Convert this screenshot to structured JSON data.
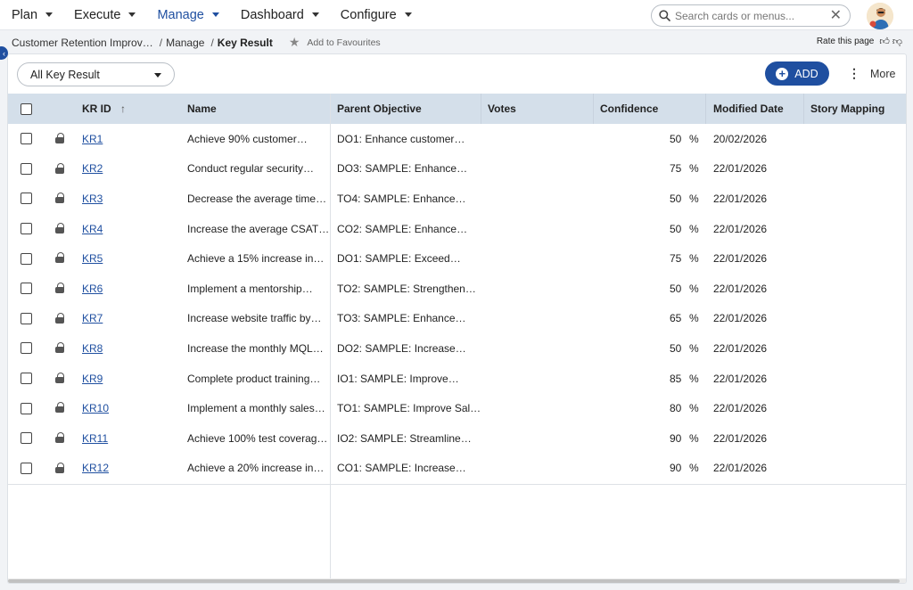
{
  "nav": {
    "items": [
      {
        "label": "Plan",
        "active": false
      },
      {
        "label": "Execute",
        "active": false
      },
      {
        "label": "Manage",
        "active": true
      },
      {
        "label": "Dashboard",
        "active": false
      },
      {
        "label": "Configure",
        "active": false
      }
    ],
    "search_placeholder": "Search cards or menus..."
  },
  "breadcrumb": {
    "items": [
      "Customer Retention Improv…",
      "Manage"
    ],
    "current": "Key Result",
    "favourite_label": "Add to Favourites",
    "rate_label": "Rate this page"
  },
  "toolbar": {
    "filter_label": "All Key Result",
    "add_label": "ADD",
    "more_label": "More"
  },
  "table": {
    "headers": {
      "kr_id": "KR ID",
      "name": "Name",
      "parent_objective": "Parent Objective",
      "votes": "Votes",
      "confidence": "Confidence",
      "modified_date": "Modified Date",
      "story_mapping": "Story Mapping"
    },
    "sort_indicator": "↑",
    "rows": [
      {
        "id": "KR1",
        "name": "Achieve 90% customer…",
        "parent": "DO1: Enhance customer…",
        "confidence": "50",
        "date": "20/02/2026"
      },
      {
        "id": "KR2",
        "name": "Conduct regular security…",
        "parent": "DO3: SAMPLE: Enhance…",
        "confidence": "75",
        "date": "22/01/2026"
      },
      {
        "id": "KR3",
        "name": "Decrease the average time…",
        "parent": "TO4: SAMPLE: Enhance…",
        "confidence": "50",
        "date": "22/01/2026"
      },
      {
        "id": "KR4",
        "name": "Increase the average CSAT…",
        "parent": "CO2: SAMPLE: Enhance…",
        "confidence": "50",
        "date": "22/01/2026"
      },
      {
        "id": "KR5",
        "name": "Achieve a 15% increase in…",
        "parent": "DO1: SAMPLE: Exceed…",
        "confidence": "75",
        "date": "22/01/2026"
      },
      {
        "id": "KR6",
        "name": "Implement a mentorship…",
        "parent": "TO2: SAMPLE: Strengthen…",
        "confidence": "50",
        "date": "22/01/2026"
      },
      {
        "id": "KR7",
        "name": "Increase website traffic by…",
        "parent": "TO3: SAMPLE: Enhance…",
        "confidence": "65",
        "date": "22/01/2026"
      },
      {
        "id": "KR8",
        "name": "Increase the monthly MQL…",
        "parent": "DO2: SAMPLE: Increase…",
        "confidence": "50",
        "date": "22/01/2026"
      },
      {
        "id": "KR9",
        "name": "Complete product training…",
        "parent": "IO1: SAMPLE: Improve…",
        "confidence": "85",
        "date": "22/01/2026"
      },
      {
        "id": "KR10",
        "name": "Implement a monthly sales…",
        "parent": "TO1: SAMPLE: Improve Sal…",
        "confidence": "80",
        "date": "22/01/2026"
      },
      {
        "id": "KR11",
        "name": "Achieve 100% test coverag…",
        "parent": "IO2: SAMPLE: Streamline…",
        "confidence": "90",
        "date": "22/01/2026"
      },
      {
        "id": "KR12",
        "name": "Achieve a 20% increase in…",
        "parent": "CO1: SAMPLE: Increase…",
        "confidence": "90",
        "date": "22/01/2026"
      }
    ],
    "percent_sign": "%"
  },
  "colors": {
    "accent": "#1f4fa0",
    "header_bg": "#d4dfea"
  }
}
